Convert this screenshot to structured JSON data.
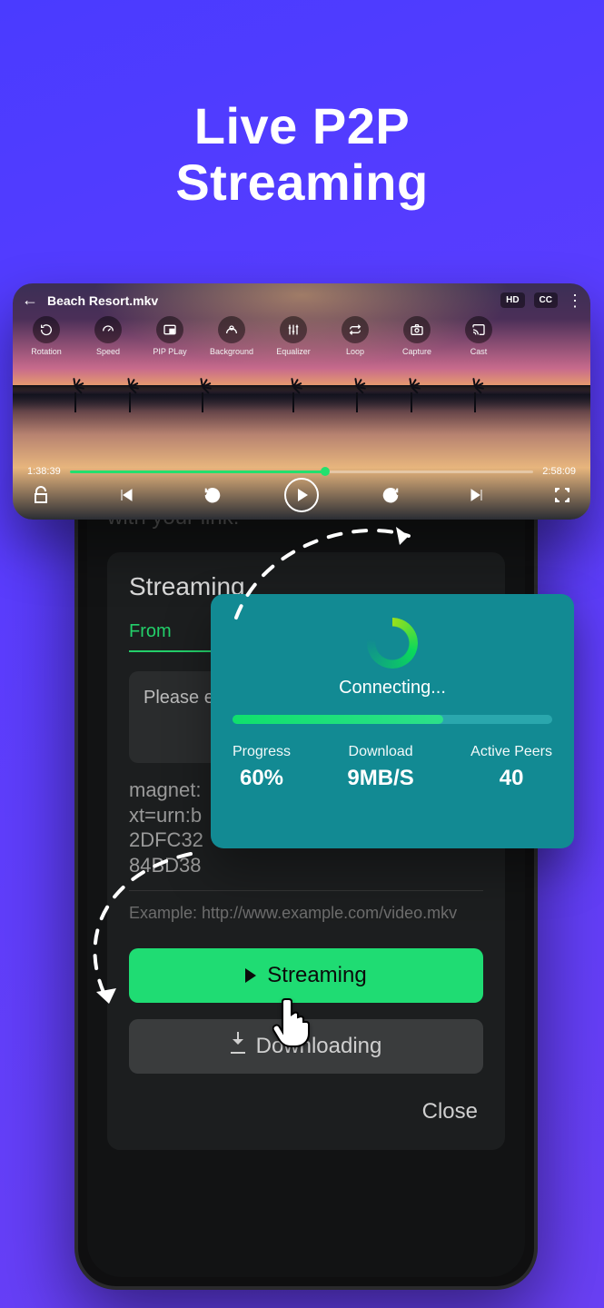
{
  "hero": {
    "line1": "Live P2P",
    "line2": "Streaming"
  },
  "player": {
    "filename": "Beach Resort.mkv",
    "badges": {
      "hd": "HD",
      "cc": "CC"
    },
    "tools": [
      {
        "name": "rotation",
        "label": "Rotation"
      },
      {
        "name": "speed",
        "label": "Speed"
      },
      {
        "name": "pip",
        "label": "PIP PLay"
      },
      {
        "name": "background",
        "label": "Background"
      },
      {
        "name": "equalizer",
        "label": "Equalizer"
      },
      {
        "name": "loop",
        "label": "Loop"
      },
      {
        "name": "capture",
        "label": "Capture"
      },
      {
        "name": "cast",
        "label": "Cast"
      }
    ],
    "time": {
      "elapsed": "1:38:39",
      "total": "2:58:09"
    },
    "controls": {
      "lock": "lock",
      "prev": "previous",
      "rew": "rewind-10",
      "play": "play",
      "fwd": "forward-10",
      "next": "next",
      "full": "fullscreen"
    }
  },
  "sheet": {
    "dim_line": "with your link:",
    "title": "Streaming",
    "tab": "From",
    "input_placeholder": "Please e",
    "magnet": "magnet:\nxt=urn:b\n2DFC32\n84BD38",
    "example": "Example: http://www.example.com/video.mkv",
    "btn_stream": "Streaming",
    "btn_download": "Downloading",
    "close": "Close"
  },
  "connect": {
    "title": "Connecting...",
    "progress_label": "Progress",
    "progress_value": "60%",
    "download_label": "Download",
    "download_value": "9MB/S",
    "peers_label": "Active Peers",
    "peers_value": "40",
    "progress_pct": 66
  }
}
